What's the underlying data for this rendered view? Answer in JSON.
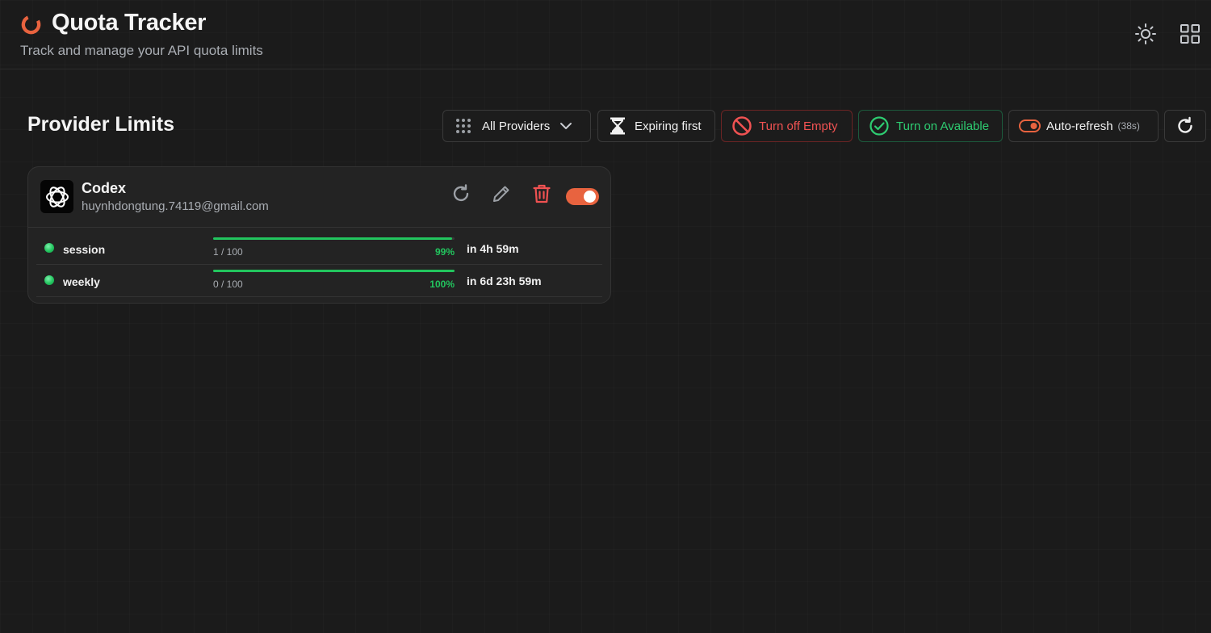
{
  "app": {
    "title": "Quota Tracker",
    "subtitle": "Track and manage your API quota limits",
    "accent_color": "#e8633f"
  },
  "header_actions": {
    "theme_icon": "sun-icon",
    "layout_icon": "grid-layout-icon"
  },
  "section": {
    "title": "Provider Limits"
  },
  "toolbar": {
    "providers_filter": "All Providers",
    "sort_label": "Expiring first",
    "turn_off_empty": "Turn off Empty",
    "turn_on_available": "Turn on Available",
    "auto_refresh": "Auto-refresh",
    "auto_refresh_countdown": "(38s)"
  },
  "providers": [
    {
      "name": "Codex",
      "email": "huynhdongtung.74119@gmail.com",
      "enabled": true,
      "limits": [
        {
          "label": "session",
          "usage": "1 / 100",
          "remaining_percent": 99,
          "percent_label": "99%",
          "resets": "in 4h 59m",
          "status_color": "#22c55e"
        },
        {
          "label": "weekly",
          "usage": "0 / 100",
          "remaining_percent": 100,
          "percent_label": "100%",
          "resets": "in 6d 23h 59m",
          "status_color": "#22c55e"
        }
      ]
    }
  ],
  "colors": {
    "danger": "#f05252",
    "success": "#2ecc71",
    "background": "#1b1b1b"
  }
}
